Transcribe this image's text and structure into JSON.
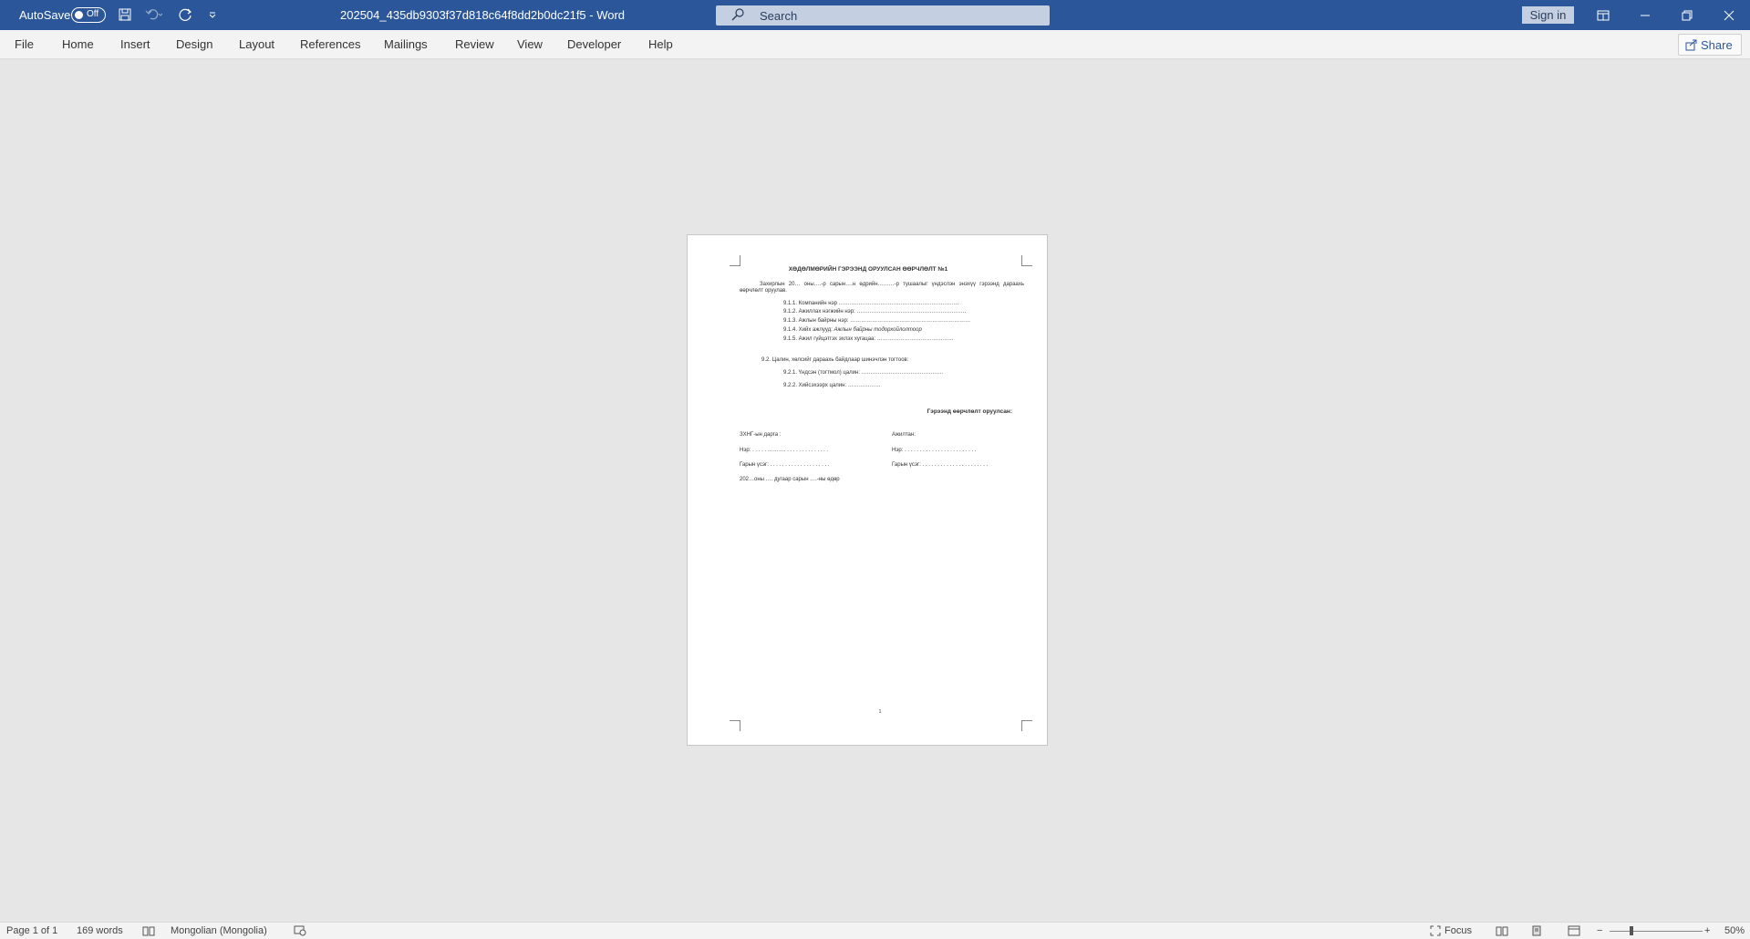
{
  "titlebar": {
    "autosave_label": "AutoSave",
    "autosave_state": "Off",
    "document_title": "202504_435db9303f37d818c64f8dd2b0dc21f5  -  Word",
    "search_placeholder": "Search",
    "sign_in_label": "Sign in"
  },
  "ribbon": {
    "tabs": [
      "File",
      "Home",
      "Insert",
      "Design",
      "Layout",
      "References",
      "Mailings",
      "Review",
      "View",
      "Developer",
      "Help"
    ],
    "share_label": "Share"
  },
  "document": {
    "heading": "ХӨДӨЛМӨРИЙН ГЭРЭЭНД ОРУУЛСАН ӨӨРЧЛӨЛТ №1",
    "intro": "Захирлын 20… оны….-р сарын….н өдрийн………-р тушаалыг үндэслэн энэхүү гэрээнд дараахь өөрчлөлт оруулав.",
    "items_91": [
      "9.1.1. Компанийн нэр …………………………………………………………",
      "9.1.2. Ажиллах нэгжийн нэр: ……………………………………………………",
      "9.1.3. Ажлын байрны нэр: …………………………………………………………",
      "9.1.5. Ажил гүйцэтгэх эхлэх хугацаа: ……………………………………"
    ],
    "item_914_prefix": "9.1.4. Хийх ажлууд:",
    "item_914_italic": "Ажлын байрны тодорхойлолтоор",
    "section_92": "9.2. Цалин, хөлсийг дараахь байдлаар шинэчлэн тогтоов:",
    "items_92": [
      "9.2.1. Үндсэн (тогтмол) цалин: ………………………………………",
      "9.2.2. Хийсэхээрх цалин: ………………"
    ],
    "signatures_heading": "Гэрээнд өөрчлөлт оруулсан:",
    "left_col": [
      "ЗХНГ-ын дарга :",
      "Нэр:  . . . . . ………. . . . . . . . . . . . . . .",
      "Гарын үсэг:  . . . . . . . . . . . . . . . . . . . ."
    ],
    "right_col": [
      "Ажилтан:",
      "Нэр:       . . . . . . . . . . . . . . . . . . . . . . . .",
      "Гарын үсэг: . . . . . . . . . . . . . . . . . . . . . ."
    ],
    "date_line": "202…оны …. дугаар сарын ….-ны өдөр",
    "page_number": "1"
  },
  "statusbar": {
    "page": "Page 1 of 1",
    "words": "169 words",
    "language": "Mongolian (Mongolia)",
    "focus_label": "Focus",
    "zoom": "50%"
  }
}
